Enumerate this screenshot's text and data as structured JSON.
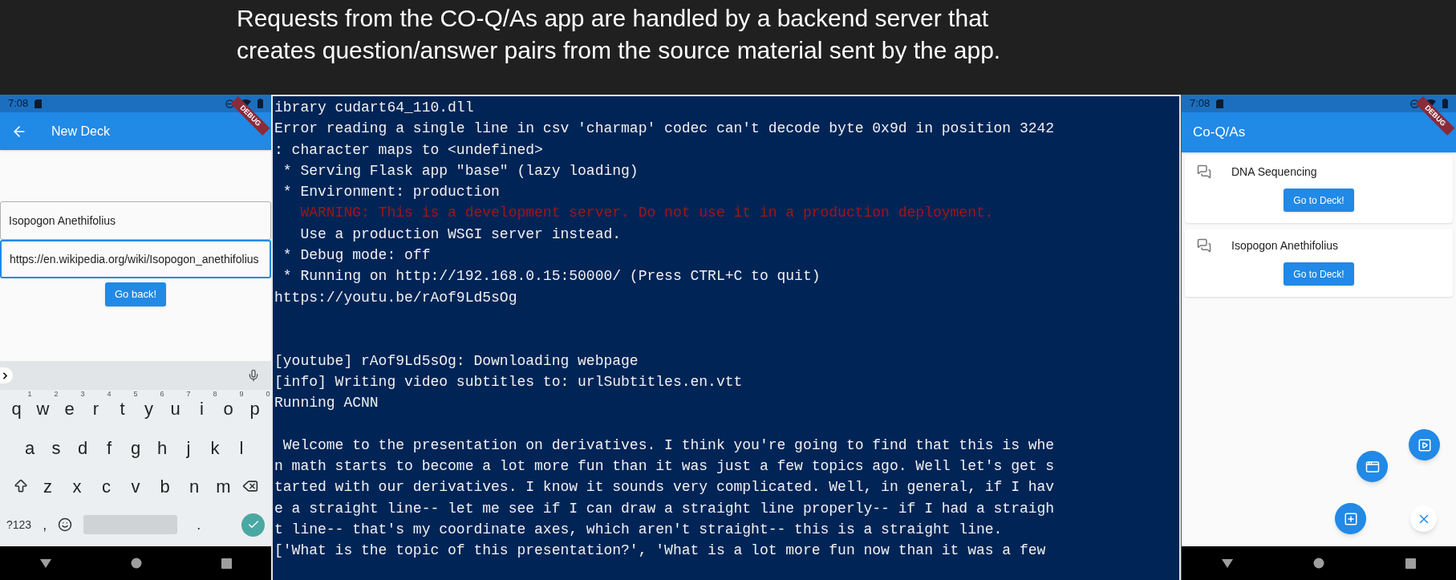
{
  "header": {
    "lines": [
      "Requests from the CO-Q/As app are handled by a backend server that",
      "creates question/answer pairs from the source material sent by the app."
    ]
  },
  "left_phone": {
    "status_bar": {
      "time": "7:08"
    },
    "debug_banner": "DEBUG",
    "app_bar": {
      "title": "New Deck"
    },
    "fields": [
      {
        "value": "Isopogon Anethifolius",
        "focused": false
      },
      {
        "value": "https://en.wikipedia.org/wiki/Isopogon_anethifolius",
        "focused": true
      }
    ],
    "button": "Go back!",
    "keyboard": {
      "rows": [
        {
          "keys": [
            {
              "key": "q",
              "hint": "1"
            },
            {
              "key": "w",
              "hint": "2"
            },
            {
              "key": "e",
              "hint": "3"
            },
            {
              "key": "r",
              "hint": "4"
            },
            {
              "key": "t",
              "hint": "5"
            },
            {
              "key": "y",
              "hint": "6"
            },
            {
              "key": "u",
              "hint": "7"
            },
            {
              "key": "i",
              "hint": "8"
            },
            {
              "key": "o",
              "hint": "9"
            },
            {
              "key": "p",
              "hint": "0"
            }
          ]
        },
        {
          "keys": [
            {
              "key": "a"
            },
            {
              "key": "s"
            },
            {
              "key": "d"
            },
            {
              "key": "f"
            },
            {
              "key": "g"
            },
            {
              "key": "h"
            },
            {
              "key": "j"
            },
            {
              "key": "k"
            },
            {
              "key": "l"
            }
          ]
        },
        {
          "keys": [
            {
              "key": "z"
            },
            {
              "key": "x"
            },
            {
              "key": "c"
            },
            {
              "key": "v"
            },
            {
              "key": "b"
            },
            {
              "key": "n"
            },
            {
              "key": "m"
            }
          ]
        }
      ],
      "symbols": "?123",
      "comma": ",",
      "period": "."
    }
  },
  "terminal": {
    "lines": [
      {
        "kind": "normal",
        "text": "ibrary cudart64_110.dll"
      },
      {
        "kind": "normal",
        "text": "Error reading a single line in csv 'charmap' codec can't decode byte 0x9d in position 3242"
      },
      {
        "kind": "normal",
        "text": ": character maps to <undefined>"
      },
      {
        "kind": "normal",
        "text": " * Serving Flask app \"base\" (lazy loading)"
      },
      {
        "kind": "normal",
        "text": " * Environment: production"
      },
      {
        "kind": "warning",
        "text": "   WARNING: This is a development server. Do not use it in a production deployment."
      },
      {
        "kind": "normal",
        "text": "   Use a production WSGI server instead."
      },
      {
        "kind": "normal",
        "text": " * Debug mode: off"
      },
      {
        "kind": "normal",
        "text": " * Running on http://192.168.0.15:50000/ (Press CTRL+C to quit)"
      },
      {
        "kind": "normal",
        "text": "https://youtu.be/rAof9Ld5sOg"
      },
      {
        "kind": "blank"
      },
      {
        "kind": "blank"
      },
      {
        "kind": "normal",
        "text": "[youtube] rAof9Ld5sOg: Downloading webpage"
      },
      {
        "kind": "normal",
        "text": "[info] Writing video subtitles to: urlSubtitles.en.vtt"
      },
      {
        "kind": "normal",
        "text": "Running ACNN"
      },
      {
        "kind": "blank"
      },
      {
        "kind": "normal",
        "text": " Welcome to the presentation on derivatives. I think you're going to find that this is whe"
      },
      {
        "kind": "normal",
        "text": "n math starts to become a lot more fun than it was just a few topics ago. Well let's get s"
      },
      {
        "kind": "normal",
        "text": "tarted with our derivatives. I know it sounds very complicated. Well, in general, if I hav"
      },
      {
        "kind": "normal",
        "text": "e a straight line-- let me see if I can draw a straight line properly-- if I had a straigh"
      },
      {
        "kind": "normal",
        "text": "t line-- that's my coordinate axes, which aren't straight-- this is a straight line."
      },
      {
        "kind": "normal",
        "text": "['What is the topic of this presentation?', 'What is a lot more fun now than it was a few"
      }
    ]
  },
  "right_phone": {
    "status_bar": {
      "time": "7:08"
    },
    "debug_banner": "DEBUG",
    "app_bar": {
      "title": "Co-Q/As"
    },
    "decks": [
      {
        "title": "DNA Sequencing",
        "button": "Go to Deck!"
      },
      {
        "title": "Isopogon Anethifolius",
        "button": "Go to Deck!"
      }
    ]
  }
}
